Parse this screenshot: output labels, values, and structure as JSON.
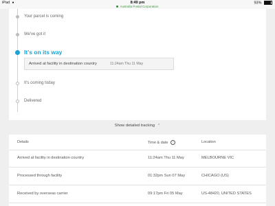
{
  "status_bar": {
    "device": "iPad",
    "time": "8:49 pm",
    "site": "Australia Postal Corporation",
    "battery": "93%"
  },
  "timeline": {
    "steps": [
      {
        "label": "Your parcel is coming",
        "state": "done"
      },
      {
        "label": "We've got it",
        "state": "done"
      },
      {
        "label": "It's on its way",
        "state": "current"
      },
      {
        "label": "It's coming today",
        "state": "pending"
      },
      {
        "label": "Delivered",
        "state": "pending"
      }
    ],
    "current_event": {
      "description": "Arrived at facility in destination country",
      "time": "11:24am Thu 11 May"
    }
  },
  "toggle_label": "Show detailed tracking",
  "table": {
    "headers": {
      "details": "Details",
      "time_date": "Time & date",
      "location": "Location"
    },
    "rows": [
      {
        "details": "Arrived at facility in destination country",
        "time": "11:24am Thu 11 May",
        "location": "MELBOURNE VIC"
      },
      {
        "details": "Processed through facility",
        "time": "01:32pm Sun 07 May",
        "location": "CHICAGO (US)"
      },
      {
        "details": "Received by overseas carrier",
        "time": "09:17pm Fri 05 May",
        "location": "US-48420, UNITED STATES"
      }
    ]
  },
  "colors": {
    "accent": "#1da1d6",
    "secure": "#3a9a3a"
  },
  "icons": {
    "info": "info-icon",
    "chevron": "chevron-up-icon",
    "lock": "lock-icon"
  }
}
